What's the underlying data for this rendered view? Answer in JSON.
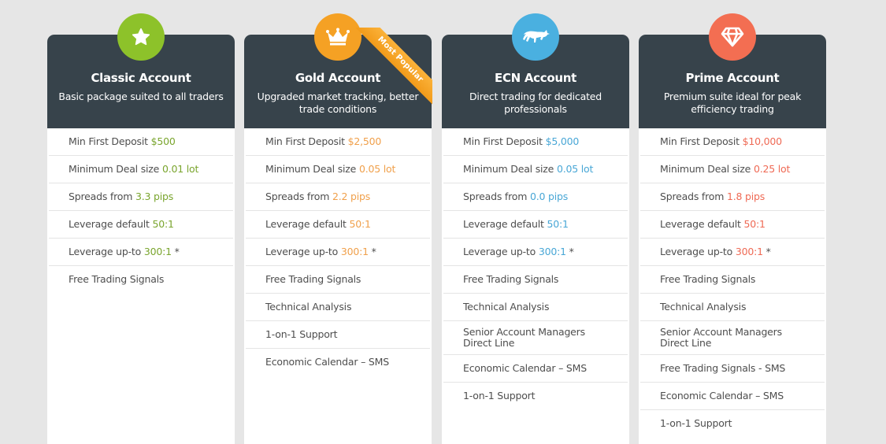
{
  "colors": {
    "background": "#e6e6e6",
    "header": "#37434b",
    "classic": "#8dc22a",
    "gold": "#f5a124",
    "ecn": "#4ab0e0",
    "prime": "#f36e52"
  },
  "plans": [
    {
      "id": "classic",
      "icon": "star-icon",
      "title": "Classic Account",
      "subtitle": "Basic package suited to all traders",
      "accent": "#7aa52e",
      "badge": null,
      "features": [
        {
          "label": "Min First Deposit ",
          "value": "$500",
          "suffix": ""
        },
        {
          "label": "Minimum Deal size ",
          "value": "0.01 lot",
          "suffix": ""
        },
        {
          "label": "Spreads from ",
          "value": "3.3 pips",
          "suffix": ""
        },
        {
          "label": "Leverage default ",
          "value": "50:1",
          "suffix": ""
        },
        {
          "label": "Leverage up-to ",
          "value": "300:1",
          "suffix": " *"
        },
        {
          "label": "Free Trading Signals",
          "value": "",
          "suffix": ""
        }
      ]
    },
    {
      "id": "gold",
      "icon": "crown-icon",
      "title": "Gold Account",
      "subtitle": "Upgraded market tracking, better trade conditions",
      "accent": "#f0a04b",
      "badge": "Most Popular",
      "features": [
        {
          "label": "Min First Deposit ",
          "value": "$2,500",
          "suffix": ""
        },
        {
          "label": "Minimum Deal size ",
          "value": "0.05 lot",
          "suffix": ""
        },
        {
          "label": "Spreads from ",
          "value": "2.2 pips",
          "suffix": ""
        },
        {
          "label": "Leverage default ",
          "value": "50:1",
          "suffix": ""
        },
        {
          "label": "Leverage up-to ",
          "value": "300:1",
          "suffix": " *"
        },
        {
          "label": "Free Trading Signals",
          "value": "",
          "suffix": ""
        },
        {
          "label": "Technical Analysis",
          "value": "",
          "suffix": ""
        },
        {
          "label": "1-on-1 Support",
          "value": "",
          "suffix": ""
        },
        {
          "label": "Economic Calendar – SMS",
          "value": "",
          "suffix": ""
        }
      ]
    },
    {
      "id": "ecn",
      "icon": "bull-icon",
      "title": "ECN Account",
      "subtitle": "Direct trading for dedicated professionals",
      "accent": "#49a7d6",
      "badge": null,
      "features": [
        {
          "label": "Min First Deposit ",
          "value": "$5,000",
          "suffix": ""
        },
        {
          "label": "Minimum Deal size ",
          "value": "0.05 lot",
          "suffix": ""
        },
        {
          "label": "Spreads from ",
          "value": "0.0 pips",
          "suffix": ""
        },
        {
          "label": "Leverage default ",
          "value": "50:1",
          "suffix": ""
        },
        {
          "label": "Leverage up-to ",
          "value": "300:1",
          "suffix": " *"
        },
        {
          "label": "Free Trading Signals",
          "value": "",
          "suffix": ""
        },
        {
          "label": "Technical Analysis",
          "value": "",
          "suffix": ""
        },
        {
          "label": "Senior Account Managers Direct Line",
          "value": "",
          "suffix": ""
        },
        {
          "label": "Economic Calendar – SMS",
          "value": "",
          "suffix": ""
        },
        {
          "label": "1-on-1 Support",
          "value": "",
          "suffix": ""
        }
      ]
    },
    {
      "id": "prime",
      "icon": "diamond-icon",
      "title": "Prime Account",
      "subtitle": "Premium suite ideal for peak efficiency trading",
      "accent": "#ef6a55",
      "badge": null,
      "features": [
        {
          "label": "Min First Deposit ",
          "value": "$10,000",
          "suffix": ""
        },
        {
          "label": "Minimum Deal size ",
          "value": "0.25 lot",
          "suffix": ""
        },
        {
          "label": "Spreads from ",
          "value": "1.8 pips",
          "suffix": ""
        },
        {
          "label": "Leverage default ",
          "value": "50:1",
          "suffix": ""
        },
        {
          "label": "Leverage up-to ",
          "value": "300:1",
          "suffix": " *"
        },
        {
          "label": "Free Trading Signals",
          "value": "",
          "suffix": ""
        },
        {
          "label": "Technical Analysis",
          "value": "",
          "suffix": ""
        },
        {
          "label": "Senior Account Managers Direct Line",
          "value": "",
          "suffix": ""
        },
        {
          "label": "Free Trading Signals - SMS",
          "value": "",
          "suffix": ""
        },
        {
          "label": "Economic Calendar – SMS",
          "value": "",
          "suffix": ""
        },
        {
          "label": "1-on-1 Support",
          "value": "",
          "suffix": ""
        }
      ]
    }
  ]
}
